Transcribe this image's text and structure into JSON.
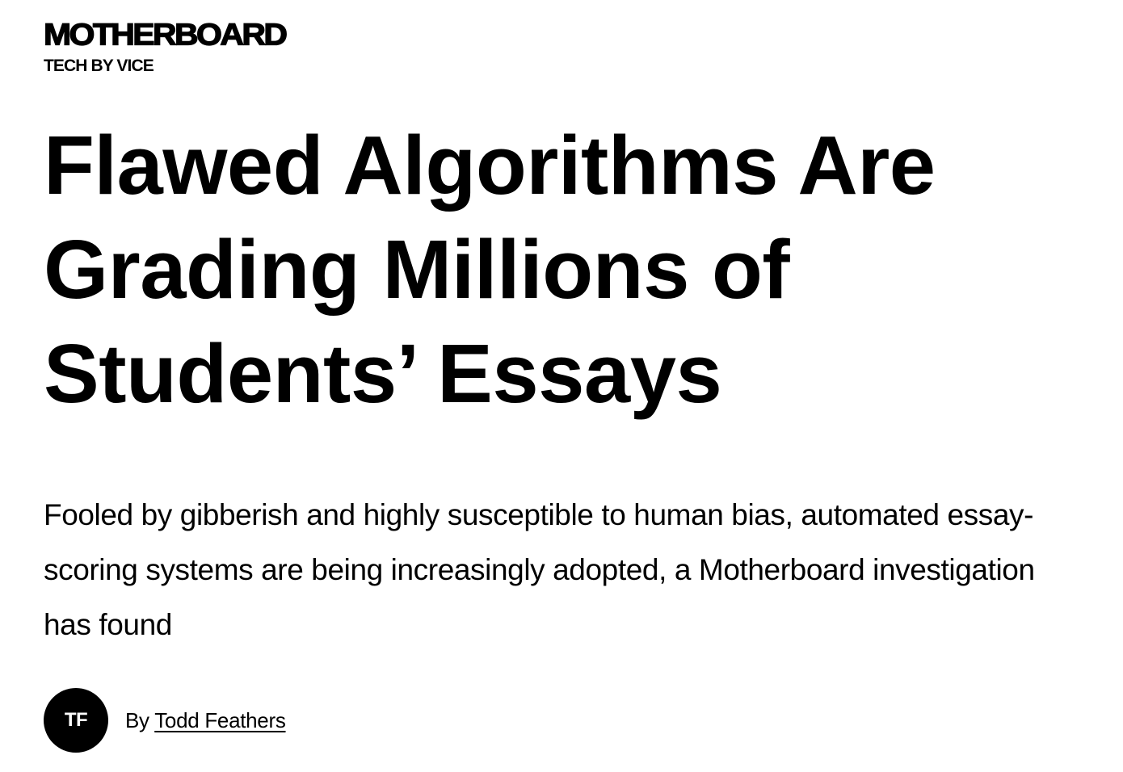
{
  "brand": {
    "wordmark": "MOTHERBOARD",
    "tagline": "TECH BY VICE"
  },
  "article": {
    "headline": "Flawed Algorithms Are Grading Millions of Students’ Essays",
    "dek": "Fooled by gibberish and highly susceptible to human bias, automated essay-scoring systems are being increasingly adopted, a Motherboard investigation has found",
    "byline": {
      "avatar_initials": "TF",
      "prefix": "By",
      "author_name": "Todd Feathers"
    }
  },
  "colors": {
    "background": "#ffffff",
    "text": "#000000",
    "avatar_bg": "#000000",
    "avatar_text": "#ffffff"
  }
}
